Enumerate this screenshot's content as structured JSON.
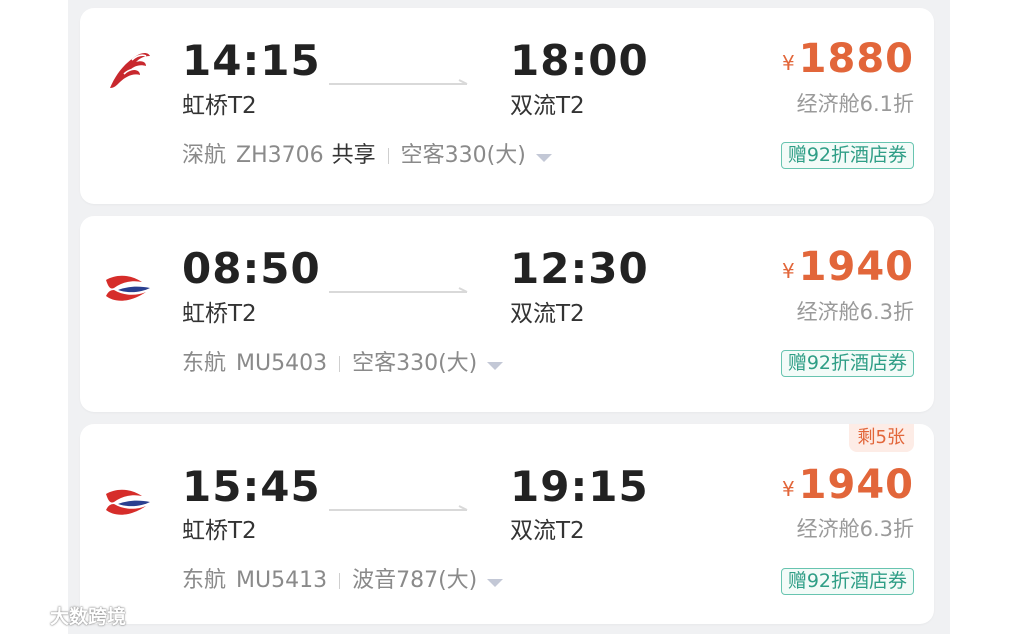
{
  "flights": [
    {
      "airline": "深航",
      "airline_logo": "shenzhen-airlines-logo",
      "flight_no": "ZH3706",
      "share_label": "共享",
      "aircraft": "空客330(大)",
      "dep_time": "14:15",
      "dep_airport": "虹桥T2",
      "arr_time": "18:00",
      "arr_airport": "双流T2",
      "currency": "¥",
      "price": "1880",
      "cabin": "经济舱6.1折",
      "coupon": "赠92折酒店券",
      "remain": ""
    },
    {
      "airline": "东航",
      "airline_logo": "china-eastern-logo",
      "flight_no": "MU5403",
      "share_label": "",
      "aircraft": "空客330(大)",
      "dep_time": "08:50",
      "dep_airport": "虹桥T2",
      "arr_time": "12:30",
      "arr_airport": "双流T2",
      "currency": "¥",
      "price": "1940",
      "cabin": "经济舱6.3折",
      "coupon": "赠92折酒店券",
      "remain": ""
    },
    {
      "airline": "东航",
      "airline_logo": "china-eastern-logo",
      "flight_no": "MU5413",
      "share_label": "",
      "aircraft": "波音787(大)",
      "dep_time": "15:45",
      "dep_airport": "虹桥T2",
      "arr_time": "19:15",
      "arr_airport": "双流T2",
      "currency": "¥",
      "price": "1940",
      "cabin": "经济舱6.3折",
      "coupon": "赠92折酒店券",
      "remain": "剩5张"
    }
  ],
  "watermark": {
    "text": "大数跨境"
  },
  "colors": {
    "price": "#e2663a",
    "coupon_border": "#68c4b0",
    "coupon_text": "#2f9e86",
    "shenzhen_red": "#c8282e",
    "eastern_red": "#d62d2a",
    "eastern_blue": "#2a3f8f",
    "background": "#f0f1f3"
  }
}
